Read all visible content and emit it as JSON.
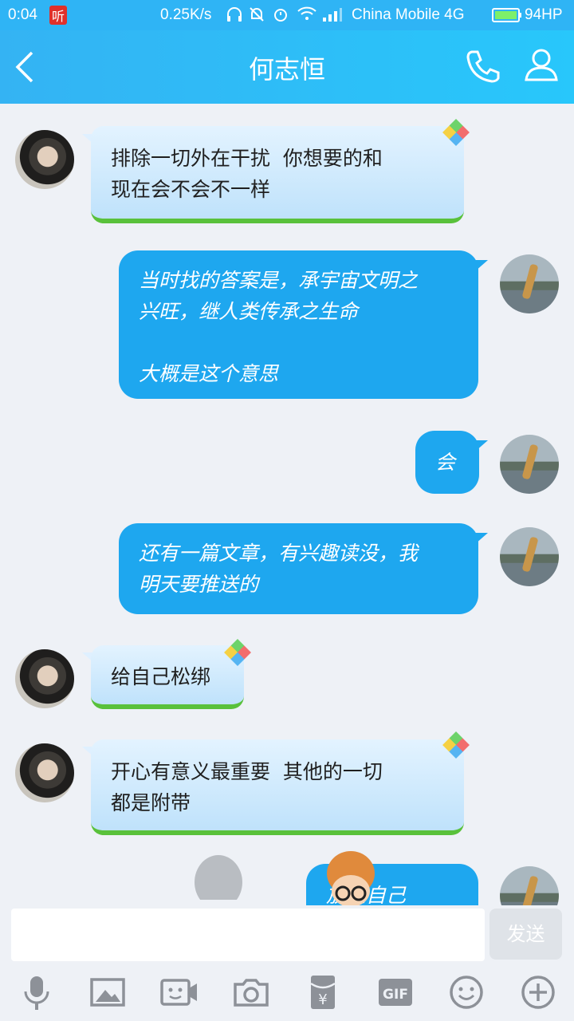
{
  "status": {
    "time": "0:04",
    "app_badge": "听",
    "speed": "0.25K/s",
    "carrier": "China Mobile 4G",
    "battery": "94HP"
  },
  "header": {
    "back_icon": "back-arrow-icon",
    "title": "何志恒",
    "call_icon": "phone-icon",
    "profile_icon": "person-icon"
  },
  "messages": [
    {
      "side": "left",
      "text": "排除一切外在干扰  你想要的和\n现在会不会不一样"
    },
    {
      "side": "right",
      "text": "当时找的答案是，承宇宙文明之\n兴旺，继人类传承之生命\n\n大概是这个意思"
    },
    {
      "side": "right",
      "text": "会"
    },
    {
      "side": "right",
      "text": "还有一篇文章，有兴趣读没，我\n明天要推送的"
    },
    {
      "side": "left",
      "text": "给自己松绑"
    },
    {
      "side": "left",
      "text": "开心有意义最重要  其他的一切\n都是附带"
    },
    {
      "side": "right",
      "text": "放空自己"
    }
  ],
  "input": {
    "placeholder": "",
    "send_label": "发送"
  },
  "toolbar": {
    "items": [
      "mic-icon",
      "image-icon",
      "video-call-icon",
      "camera-icon",
      "red-packet-icon",
      "gif-icon",
      "emoji-icon",
      "plus-icon"
    ],
    "gif_label": "GIF",
    "yen_label": "¥"
  },
  "colors": {
    "header": "#2fb4f5",
    "bubble_out": "#1ea7ef",
    "bubble_in": "#cfe9fd",
    "background": "#eef1f6"
  }
}
